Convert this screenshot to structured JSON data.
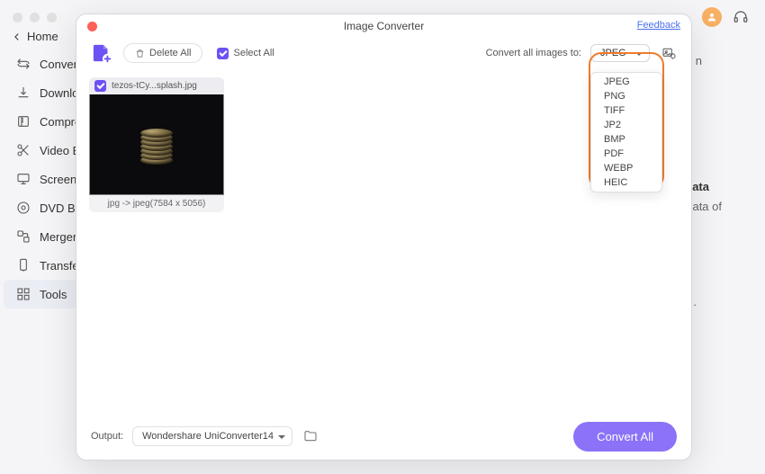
{
  "bg": {
    "home": "Home",
    "sidebar": [
      {
        "icon": "convert",
        "label": "Converter"
      },
      {
        "icon": "download",
        "label": "Downloader"
      },
      {
        "icon": "compress",
        "label": "Compressor"
      },
      {
        "icon": "scissors",
        "label": "Video Editor"
      },
      {
        "icon": "monitor",
        "label": "Screen Recorder"
      },
      {
        "icon": "disc",
        "label": "DVD Burner"
      },
      {
        "icon": "merge",
        "label": "Merger"
      },
      {
        "icon": "transfer",
        "label": "Transfer"
      },
      {
        "icon": "grid",
        "label": "Tools"
      }
    ],
    "frag_n": "n",
    "frag_ata": "ata",
    "frag_adata": "adata of",
    "frag_punct": "."
  },
  "modal": {
    "title": "Image Converter",
    "feedback": "Feedback",
    "toolbar": {
      "delete_all": "Delete All",
      "select_all": "Select All",
      "convert_to_label": "Convert all images to:",
      "format_selected": "JPEG",
      "format_options": [
        "JPEG",
        "PNG",
        "TIFF",
        "JP2",
        "BMP",
        "PDF",
        "WEBP",
        "HEIC"
      ]
    },
    "thumb": {
      "filename": "tezos-tCy...splash.jpg",
      "meta": "jpg -> jpeg(7584 x 5056)"
    },
    "bottom": {
      "output_label": "Output:",
      "output_path": "Wondershare UniConverter14",
      "convert_btn": "Convert All"
    }
  }
}
